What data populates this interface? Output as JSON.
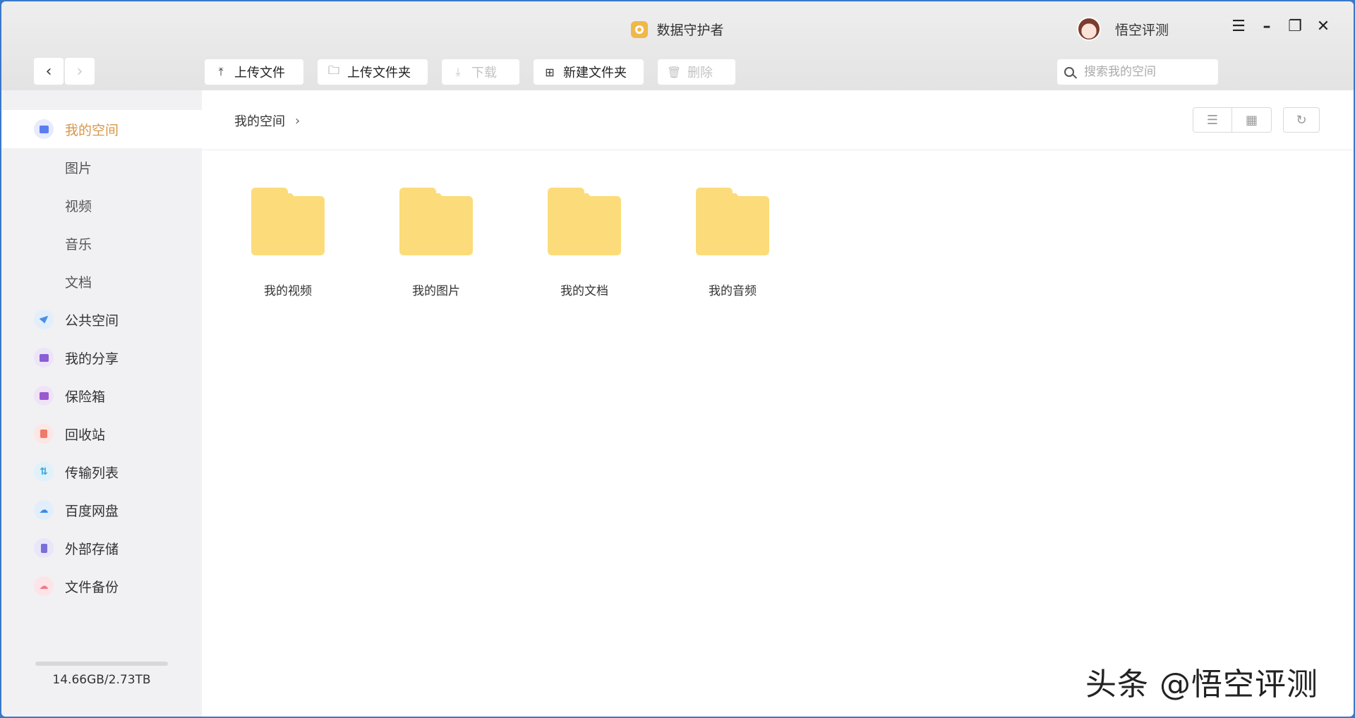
{
  "window": {
    "title": "数据守护者"
  },
  "user": {
    "name": "悟空评测"
  },
  "toolbar": {
    "upload_file": "上传文件",
    "upload_folder": "上传文件夹",
    "download": "下载",
    "new_folder": "新建文件夹",
    "delete": "删除"
  },
  "search": {
    "placeholder": "搜索我的空间"
  },
  "sidebar": {
    "items": [
      {
        "label": "我的空间",
        "icon": "folder-icon",
        "color": "#5b7df2",
        "active": true
      },
      {
        "label": "图片",
        "sub": true
      },
      {
        "label": "视频",
        "sub": true
      },
      {
        "label": "音乐",
        "sub": true
      },
      {
        "label": "文档",
        "sub": true
      },
      {
        "label": "公共空间",
        "icon": "paper-plane-icon",
        "color": "#4a90e2"
      },
      {
        "label": "我的分享",
        "icon": "share-icon",
        "color": "#8a5cd6"
      },
      {
        "label": "保险箱",
        "icon": "safe-icon",
        "color": "#9b59d0"
      },
      {
        "label": "回收站",
        "icon": "trash-icon",
        "color": "#f07a6a"
      },
      {
        "label": "传输列表",
        "icon": "transfer-icon",
        "color": "#3aa6d8"
      },
      {
        "label": "百度网盘",
        "icon": "cloud-icon",
        "color": "#3a8be0"
      },
      {
        "label": "外部存储",
        "icon": "usb-icon",
        "color": "#7a6fd8"
      },
      {
        "label": "文件备份",
        "icon": "backup-cloud-icon",
        "color": "#f07a8a"
      }
    ],
    "storage": "14.66GB/2.73TB"
  },
  "breadcrumb": {
    "current": "我的空间"
  },
  "folders": [
    {
      "name": "我的视频"
    },
    {
      "name": "我的图片"
    },
    {
      "name": "我的文档"
    },
    {
      "name": "我的音频"
    }
  ],
  "watermark": "头条 @悟空评测"
}
